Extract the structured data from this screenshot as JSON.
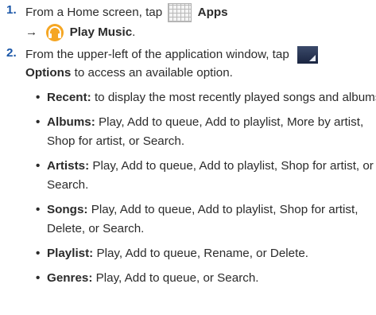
{
  "steps": [
    {
      "num": "1.",
      "line1_pre": "From a Home screen, tap",
      "apps_label": "Apps",
      "arrow": "→",
      "music_label": "Play Music",
      "end": "."
    },
    {
      "num": "2.",
      "line1": "From the upper-left of the application window, tap",
      "options_label": "Options",
      "line2_rest": "to access an available option."
    }
  ],
  "options": [
    {
      "term": "Recent:",
      "lines": [
        "to display the most recently played songs and albums"
      ]
    },
    {
      "term": "Albums:",
      "lines": [
        "Play, Add to queue, Add to playlist, More by artist,",
        "Shop for artist, or Search."
      ]
    },
    {
      "term": "Artists:",
      "lines": [
        "Play, Add to queue, Add to playlist, Shop for artist, or",
        "Search."
      ]
    },
    {
      "term": "Songs:",
      "lines": [
        "Play, Add to queue, Add to playlist, Shop for artist,",
        "Delete, or Search."
      ]
    },
    {
      "term": "Playlist:",
      "lines": [
        "Play, Add to queue, Rename, or Delete."
      ]
    },
    {
      "term": "Genres:",
      "lines": [
        "Play, Add to queue, or Search."
      ]
    }
  ],
  "bullet_char": "•"
}
